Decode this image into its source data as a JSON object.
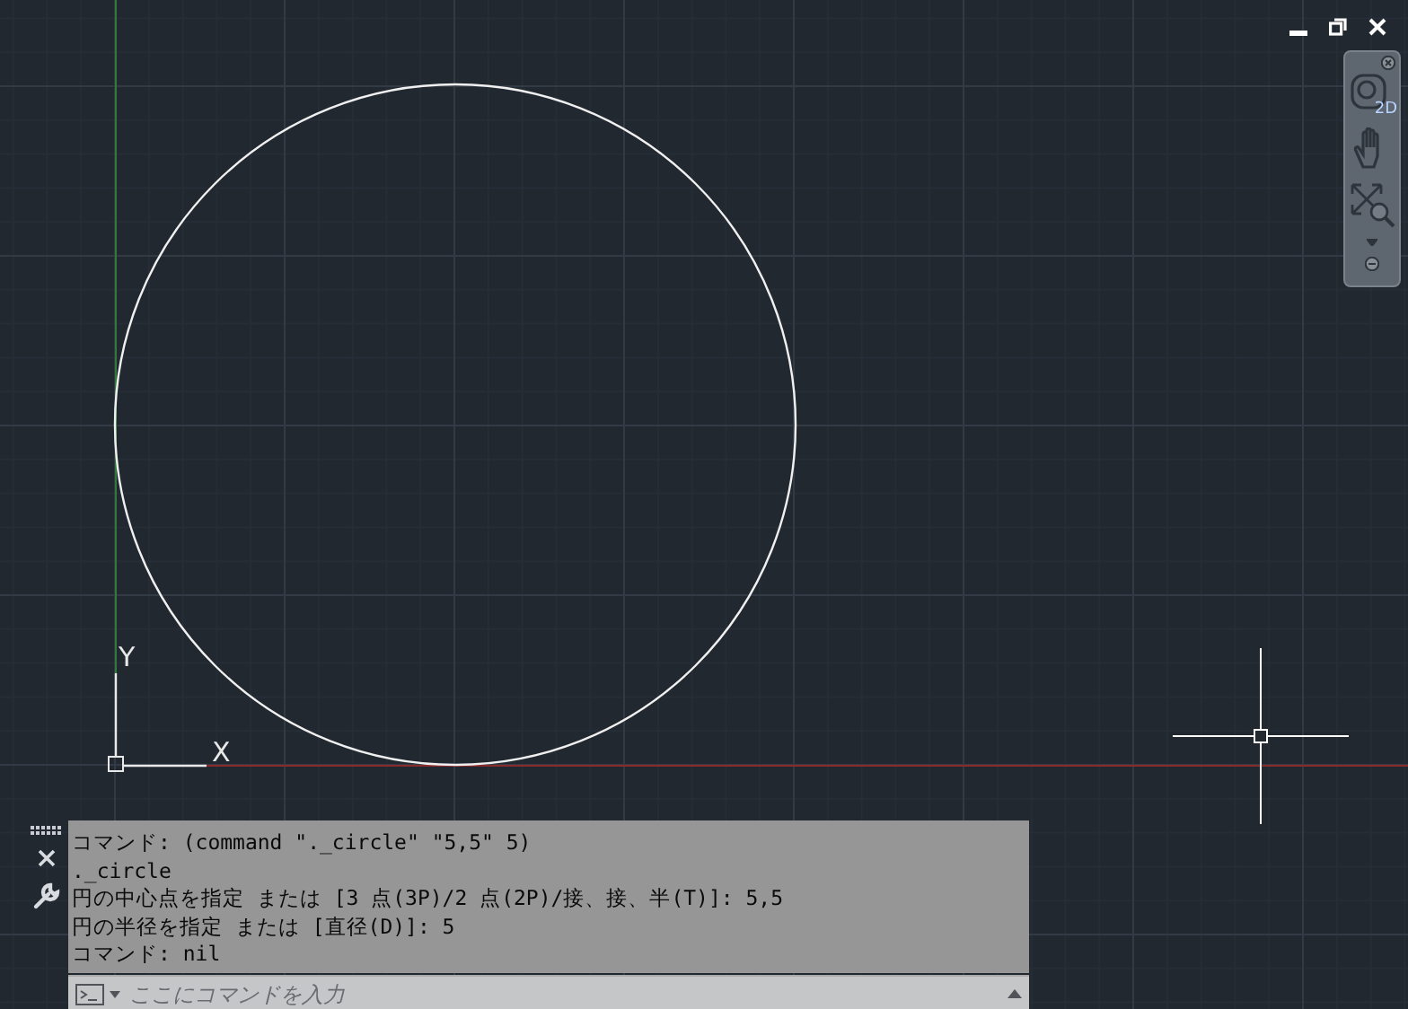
{
  "ucs": {
    "y_label": "Y",
    "x_label": "X"
  },
  "navigation_bar": {
    "wheel_label": "2D"
  },
  "command_window": {
    "history": [
      "コマンド: (command \"._circle\" \"5,5\" 5)",
      "._circle",
      "円の中心点を指定 または [3 点(3P)/2 点(2P)/接、接、半(T)]: 5,5",
      "円の半径を指定 または [直径(D)]: 5",
      "コマンド: nil"
    ],
    "input": {
      "placeholder": "ここにコマンドを入力"
    }
  }
}
